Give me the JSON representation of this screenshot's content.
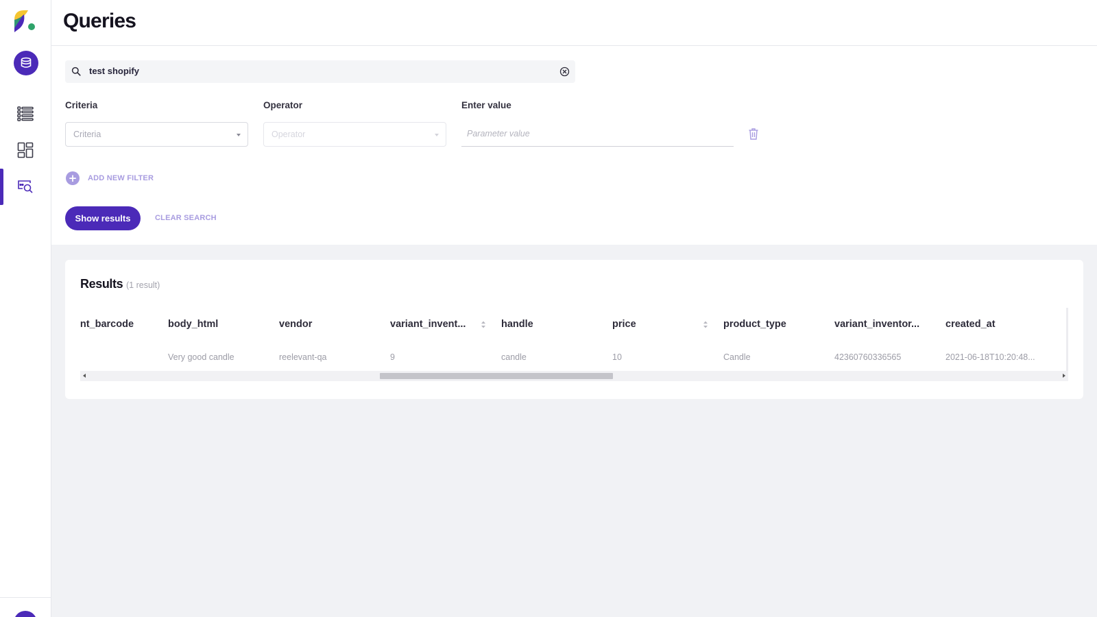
{
  "header": {
    "title": "Queries"
  },
  "sidebar": {
    "items": [
      {
        "icon": "database-icon",
        "active": false
      },
      {
        "icon": "list-icon",
        "active": false
      },
      {
        "icon": "dashboard-icon",
        "active": false
      },
      {
        "icon": "query-search-icon",
        "active": true
      }
    ]
  },
  "search": {
    "value": "test shopify"
  },
  "filters": {
    "criteria_label": "Criteria",
    "criteria_placeholder": "Criteria",
    "operator_label": "Operator",
    "operator_placeholder": "Operator",
    "value_label": "Enter value",
    "value_placeholder": "Parameter value",
    "add_filter_label": "ADD NEW FILTER"
  },
  "actions": {
    "show_results": "Show results",
    "clear_search": "CLEAR SEARCH"
  },
  "results": {
    "title": "Results",
    "count": "(1 result)",
    "columns": [
      "variant_barcode",
      "body_html",
      "vendor",
      "variant_invent...",
      "handle",
      "price",
      "product_type",
      "variant_inventor...",
      "created_at"
    ],
    "sortable": [
      false,
      false,
      false,
      true,
      false,
      true,
      false,
      false,
      false
    ],
    "rows": [
      [
        "",
        "Very good candle",
        "reelevant-qa",
        "9",
        "candle",
        "10",
        "Candle",
        "42360760336565",
        "2021-06-18T10:20:48..."
      ]
    ]
  },
  "colors": {
    "accent": "#4b2ab8",
    "accent_light": "#a89ce0",
    "background": "#f1f2f5"
  }
}
